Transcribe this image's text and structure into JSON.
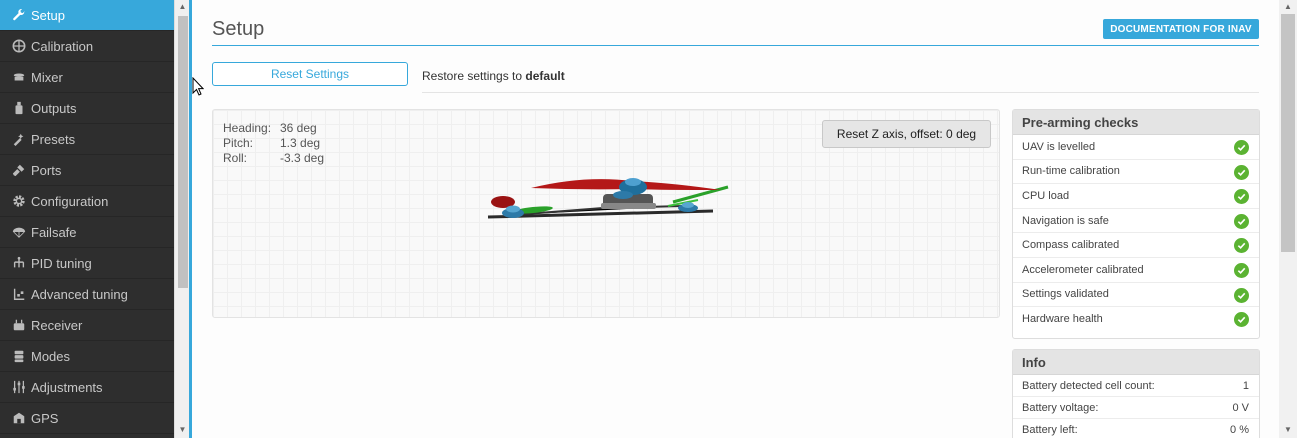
{
  "sidebar": {
    "items": [
      {
        "label": "Setup",
        "icon": "wrench-icon",
        "active": true
      },
      {
        "label": "Calibration",
        "icon": "target-icon",
        "active": false
      },
      {
        "label": "Mixer",
        "icon": "mixer-icon",
        "active": false
      },
      {
        "label": "Outputs",
        "icon": "outputs-icon",
        "active": false
      },
      {
        "label": "Presets",
        "icon": "presets-icon",
        "active": false
      },
      {
        "label": "Ports",
        "icon": "plug-icon",
        "active": false
      },
      {
        "label": "Configuration",
        "icon": "gear-icon",
        "active": false
      },
      {
        "label": "Failsafe",
        "icon": "parachute-icon",
        "active": false
      },
      {
        "label": "PID tuning",
        "icon": "pid-icon",
        "active": false
      },
      {
        "label": "Advanced tuning",
        "icon": "advanced-icon",
        "active": false
      },
      {
        "label": "Receiver",
        "icon": "receiver-icon",
        "active": false
      },
      {
        "label": "Modes",
        "icon": "modes-icon",
        "active": false
      },
      {
        "label": "Adjustments",
        "icon": "sliders-icon",
        "active": false
      },
      {
        "label": "GPS",
        "icon": "gps-icon",
        "active": false
      }
    ]
  },
  "header": {
    "title": "Setup",
    "doc_button": "DOCUMENTATION FOR INAV"
  },
  "reset": {
    "button_label": "Reset Settings",
    "restore_prefix": "Restore settings to",
    "restore_target": "default"
  },
  "model": {
    "heading_label": "Heading:",
    "heading_value": "36 deg",
    "pitch_label": "Pitch:",
    "pitch_value": "1.3 deg",
    "roll_label": "Roll:",
    "roll_value": "-3.3 deg",
    "reset_z_label": "Reset Z axis, offset: 0 deg"
  },
  "checks": {
    "title": "Pre-arming checks",
    "items": [
      {
        "label": "UAV is levelled",
        "ok": true
      },
      {
        "label": "Run-time calibration",
        "ok": true
      },
      {
        "label": "CPU load",
        "ok": true
      },
      {
        "label": "Navigation is safe",
        "ok": true
      },
      {
        "label": "Compass calibrated",
        "ok": true
      },
      {
        "label": "Accelerometer calibrated",
        "ok": true
      },
      {
        "label": "Settings validated",
        "ok": true
      },
      {
        "label": "Hardware health",
        "ok": true
      }
    ]
  },
  "info": {
    "title": "Info",
    "rows": [
      {
        "label": "Battery detected cell count:",
        "value": "1"
      },
      {
        "label": "Battery voltage:",
        "value": "0 V"
      },
      {
        "label": "Battery left:",
        "value": "0 %"
      }
    ]
  },
  "colors": {
    "accent": "#37a8db",
    "sidebar_bg": "#2e2e2e",
    "check_ok": "#5bb332"
  }
}
